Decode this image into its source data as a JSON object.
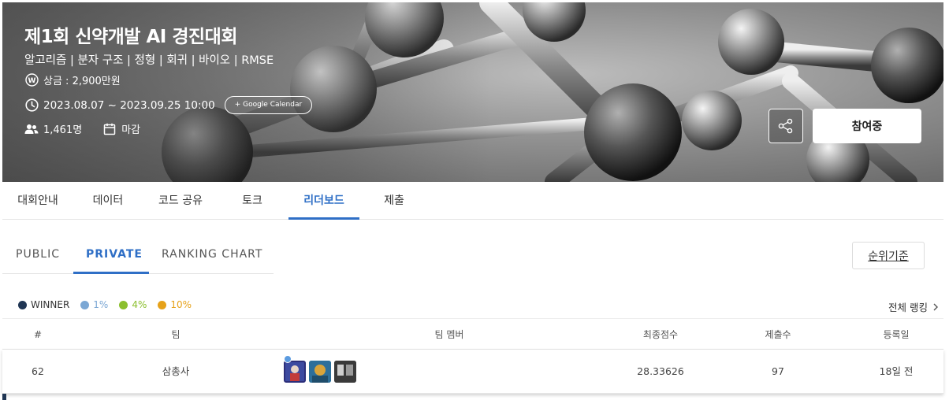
{
  "banner": {
    "title": "제1회 신약개발 AI 경진대회",
    "tags": "알고리즘 | 분자 구조 | 정형 | 회귀 | 바이오 | RMSE",
    "prize": "상금 : 2,900만원",
    "period": "2023.08.07 ~ 2023.09.25 10:00",
    "google_calendar": "+ Google Calendar",
    "participants": "1,461명",
    "status": "마감",
    "join_button": "참여중"
  },
  "main_tabs": [
    {
      "label": "대회안내"
    },
    {
      "label": "데이터"
    },
    {
      "label": "코드 공유"
    },
    {
      "label": "토크"
    },
    {
      "label": "리더보드"
    },
    {
      "label": "제출"
    }
  ],
  "active_main_tab": "리더보드",
  "sub_tabs": [
    {
      "label": "PUBLIC"
    },
    {
      "label": "PRIVATE"
    },
    {
      "label": "RANKING CHART"
    }
  ],
  "active_sub_tab": "PRIVATE",
  "ranking_criteria_button": "순위기준",
  "legend": [
    {
      "label": "WINNER",
      "color": "#1f3553"
    },
    {
      "label": "1%",
      "color": "#7ba7d4"
    },
    {
      "label": "4%",
      "color": "#8bbf2e"
    },
    {
      "label": "10%",
      "color": "#e6a21a"
    }
  ],
  "all_ranking_link": "전체 랭킹",
  "table": {
    "headers": [
      "#",
      "팀",
      "팀 멤버",
      "최종점수",
      "제출수",
      "등록일"
    ],
    "rows": [
      {
        "rank": "62",
        "team": "삼총사",
        "score": "28.33626",
        "submissions": "97",
        "registered": "18일 전"
      }
    ]
  },
  "accent_color": "#2f6fc6"
}
